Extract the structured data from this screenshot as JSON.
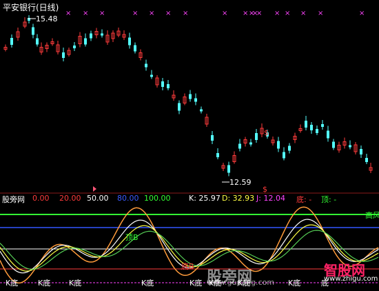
{
  "window": {
    "title": "平安银行(日线)"
  },
  "main_chart": {
    "high_label": "15.48",
    "low_label": "12.59",
    "marker_glyph": "×",
    "dollar_glyph": "$",
    "colors": {
      "up": "#ff3b3b",
      "down": "#54ffff",
      "x_marker": "#ff44ff",
      "label": "#ffffff"
    }
  },
  "indicator": {
    "name": "股旁网",
    "levels": [
      {
        "text": "0.00",
        "color": "#ff3b3b"
      },
      {
        "text": "20.00",
        "color": "#ff3b3b"
      },
      {
        "text": "50.00",
        "color": "#ffffff"
      },
      {
        "text": "80.00",
        "color": "#3b5bff"
      },
      {
        "text": "100.00",
        "color": "#33ff33"
      }
    ],
    "values": [
      {
        "text": "K: 25.97",
        "color": "#ffffff"
      },
      {
        "text": "D: 32.93",
        "color": "#ffff44"
      },
      {
        "text": "J: 12.04",
        "color": "#ff44ff"
      },
      {
        "text": "底: -",
        "color": "#ff3b3b"
      },
      {
        "text": "顶: -",
        "color": "#33ff33"
      }
    ],
    "annotations": {
      "high_risk": "高风",
      "top_b": "顶B",
      "bottom_b": "底B",
      "k_bottom": "K底",
      "bottom": "底"
    },
    "colors": {
      "k": "#ffffff",
      "d": "#ffff44",
      "j": "#ff9b3b",
      "ma": "#55cc55"
    }
  },
  "watermarks": {
    "gupang": "股旁网",
    "domain": "www.gupang.com",
    "zhigu": "智股网"
  }
}
